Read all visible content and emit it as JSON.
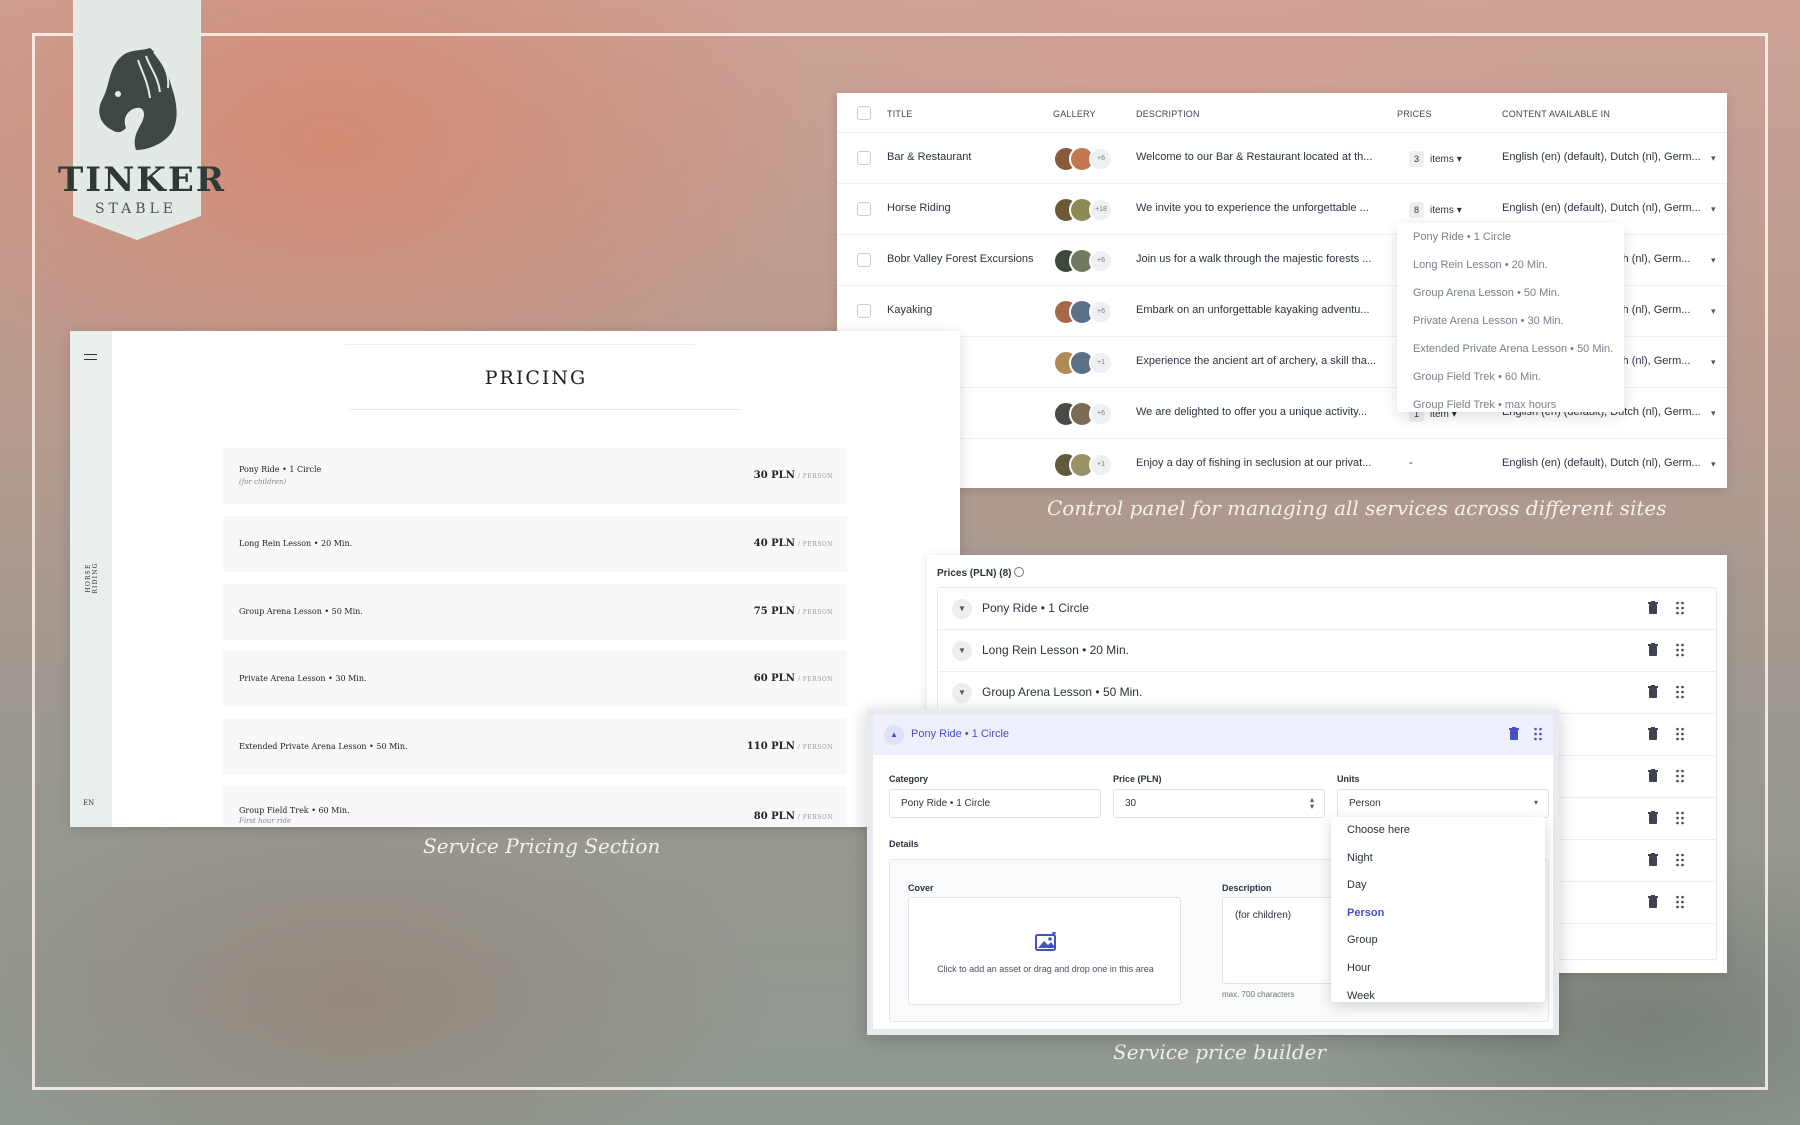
{
  "brand": {
    "name": "TINKER",
    "sub": "STABLE"
  },
  "captions": {
    "control_panel": "Control panel for managing all services across different sites",
    "pricing": "Service Pricing Section",
    "builder": "Service price builder"
  },
  "control_panel": {
    "headers": [
      "TITLE",
      "GALLERY",
      "DESCRIPTION",
      "PRICES",
      "CONTENT AVAILABLE IN"
    ],
    "rows": [
      {
        "title": "Bar & Restaurant",
        "gallery_more": "+6",
        "description": "Welcome to our Bar & Restaurant located at th...",
        "price_count": "3",
        "price_unit": "items",
        "content": "English (en) (default), Dutch (nl), Germ..."
      },
      {
        "title": "Horse Riding",
        "gallery_more": "+18",
        "description": "We invite you to experience the unforgettable ...",
        "price_count": "8",
        "price_unit": "items",
        "content": "English (en) (default), Dutch (nl), Germ..."
      },
      {
        "title": "Bobr Valley Forest Excursions",
        "gallery_more": "+6",
        "description": "Join us for a walk through the majestic forests ...",
        "price_count": "",
        "price_unit": "",
        "content": "tch (nl), Germ..."
      },
      {
        "title": "Kayaking",
        "gallery_more": "+6",
        "description": "Embark on an unforgettable kayaking adventu...",
        "price_count": "",
        "price_unit": "",
        "content": "tch (nl), Germ..."
      },
      {
        "title": "",
        "gallery_more": "+1",
        "description": "Experience the ancient art of archery, a skill tha...",
        "price_count": "",
        "price_unit": "",
        "content": "tch (nl), Germ..."
      },
      {
        "title": "",
        "gallery_more": "+6",
        "description": "We are delighted to offer you a unique activity...",
        "price_count": "1",
        "price_unit": "item",
        "content": "English (en) (default), Dutch (nl), Germ..."
      },
      {
        "title": "",
        "gallery_more": "+1",
        "description": "Enjoy a day of fishing in seclusion at our privat...",
        "price_count": "-",
        "price_unit": "",
        "content": "English (en) (default), Dutch (nl), Germ..."
      }
    ],
    "price_dropdown": [
      "Pony Ride • 1 Circle",
      "Long Rein Lesson • 20 Min.",
      "Group Arena Lesson • 50 Min.",
      "Private Arena Lesson • 30 Min.",
      "Extended Private Arena Lesson • 50 Min.",
      "Group Field Trek • 60 Min.",
      "Group Field Trek • max hours"
    ]
  },
  "pricing_page": {
    "side_label": "HORSE RIDING",
    "language": "EN",
    "title": "PRICING",
    "unit_label": "/ PERSON",
    "rows": [
      {
        "name": "Pony Ride • 1 Circle",
        "note": "(for children)",
        "price": "30 PLN"
      },
      {
        "name": "Long Rein Lesson • 20 Min.",
        "note": "",
        "price": "40 PLN"
      },
      {
        "name": "Group Arena Lesson • 50 Min.",
        "note": "",
        "price": "75 PLN"
      },
      {
        "name": "Private Arena Lesson • 30 Min.",
        "note": "",
        "price": "60 PLN"
      },
      {
        "name": "Extended Private Arena Lesson • 50 Min.",
        "note": "",
        "price": "110 PLN"
      },
      {
        "name": "Group Field Trek • 60 Min.",
        "note": "First hour ride",
        "price": "80 PLN"
      }
    ]
  },
  "prices_list": {
    "title": "Prices (PLN) (8)",
    "rows": [
      "Pony Ride • 1 Circle",
      "Long Rein Lesson • 20 Min.",
      "Group Arena Lesson • 50 Min.",
      "",
      "",
      "",
      "",
      ""
    ]
  },
  "builder": {
    "title": "Pony Ride • 1 Circle",
    "category_label": "Category",
    "category_value": "Pony Ride • 1 Circle",
    "price_label": "Price (PLN)",
    "price_value": "30",
    "units_label": "Units",
    "units_value": "Person",
    "details_label": "Details",
    "cover_label": "Cover",
    "cover_hint": "Click to add an asset or drag and drop one in this area",
    "description_label": "Description",
    "description_value": "(for children)",
    "char_limit": "max. 700 characters",
    "unit_options": [
      "Choose here",
      "Night",
      "Day",
      "Person",
      "Group",
      "Hour",
      "Week"
    ],
    "selected_unit": "Person"
  }
}
